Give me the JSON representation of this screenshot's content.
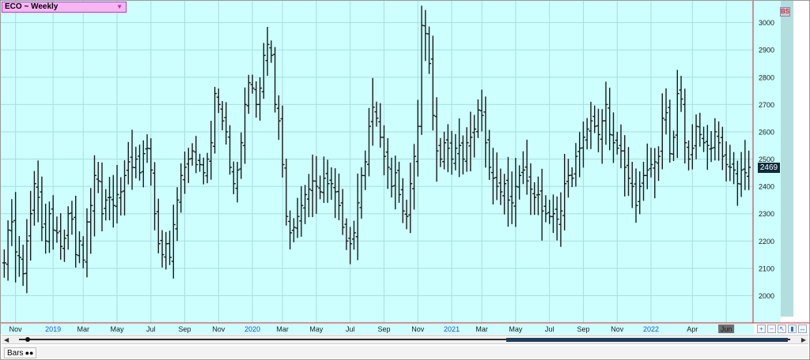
{
  "symbol_box": {
    "label": "ECO ~ Weekly"
  },
  "badge": "BS",
  "last_price_label": "2469",
  "status_tab": {
    "label": "Bars",
    "icon": "binoculars-icon"
  },
  "toolbar_icons": [
    "zoom-in-icon",
    "zoom-out-icon",
    "cursor-icon",
    "chart-icon",
    "expand-icon"
  ],
  "colors": {
    "background": "#ccfffe",
    "grid": "#a9dede",
    "bar": "#1a1a1a",
    "axis_band": "#b3dede",
    "red_line": "#d02030"
  },
  "chart_data": {
    "type": "ohlc",
    "ylim": [
      1900,
      3080
    ],
    "y_ticks": [
      2000,
      2100,
      2200,
      2300,
      2400,
      2500,
      2600,
      2700,
      2800,
      2900,
      3000
    ],
    "last_price": 2469,
    "x_ticks": [
      {
        "label": "Nov",
        "week": 3,
        "year": false
      },
      {
        "label": "2019",
        "week": 13,
        "year": true
      },
      {
        "label": "Mar",
        "week": 21,
        "year": false
      },
      {
        "label": "May",
        "week": 30,
        "year": false
      },
      {
        "label": "Jul",
        "week": 39,
        "year": false
      },
      {
        "label": "Sep",
        "week": 48,
        "year": false
      },
      {
        "label": "Nov",
        "week": 57,
        "year": false
      },
      {
        "label": "2020",
        "week": 66,
        "year": true
      },
      {
        "label": "Mar",
        "week": 74,
        "year": false
      },
      {
        "label": "May",
        "week": 83,
        "year": false
      },
      {
        "label": "Jul",
        "week": 92,
        "year": false
      },
      {
        "label": "Sep",
        "week": 101,
        "year": false
      },
      {
        "label": "Nov",
        "week": 110,
        "year": false
      },
      {
        "label": "2021",
        "week": 119,
        "year": true
      },
      {
        "label": "Mar",
        "week": 127,
        "year": false
      },
      {
        "label": "May",
        "week": 136,
        "year": false
      },
      {
        "label": "Jul",
        "week": 145,
        "year": false
      },
      {
        "label": "Sep",
        "week": 154,
        "year": false
      },
      {
        "label": "Nov",
        "week": 163,
        "year": false
      },
      {
        "label": "2022",
        "week": 172,
        "year": true
      },
      {
        "label": "Apr",
        "week": 183,
        "year": false
      },
      {
        "label": "Jun",
        "week": 192,
        "year": false
      }
    ],
    "values": [
      2120,
      2240,
      2270,
      2160,
      2140,
      2080,
      2200,
      2300,
      2410,
      2360,
      2250,
      2200,
      2300,
      2240,
      2230,
      2180,
      2210,
      2300,
      2280,
      2150,
      2200,
      2130,
      2270,
      2330,
      2440,
      2420,
      2300,
      2350,
      2360,
      2330,
      2370,
      2380,
      2440,
      2490,
      2470,
      2500,
      2450,
      2520,
      2540,
      2460,
      2300,
      2190,
      2150,
      2190,
      2140,
      2260,
      2350,
      2440,
      2470,
      2500,
      2530,
      2480,
      2480,
      2450,
      2500,
      2560,
      2740,
      2700,
      2640,
      2600,
      2470,
      2410,
      2460,
      2560,
      2700,
      2780,
      2760,
      2700,
      2760,
      2880,
      2920,
      2880,
      2700,
      2640,
      2480,
      2290,
      2230,
      2250,
      2290,
      2330,
      2370,
      2390,
      2420,
      2400,
      2380,
      2430,
      2410,
      2410,
      2380,
      2330,
      2250,
      2200,
      2190,
      2230,
      2340,
      2440,
      2490,
      2620,
      2690,
      2650,
      2580,
      2510,
      2470,
      2400,
      2450,
      2370,
      2310,
      2290,
      2410,
      2510,
      2620,
      2990,
      2960,
      2850,
      2660,
      2530,
      2500,
      2560,
      2540,
      2500,
      2540,
      2550,
      2500,
      2560,
      2580,
      2610,
      2680,
      2660,
      2560,
      2470,
      2430,
      2400,
      2380,
      2410,
      2350,
      2340,
      2400,
      2440,
      2460,
      2420,
      2390,
      2360,
      2370,
      2310,
      2300,
      2290,
      2300,
      2280,
      2310,
      2410,
      2440,
      2430,
      2510,
      2540,
      2580,
      2610,
      2640,
      2620,
      2590,
      2640,
      2700,
      2590,
      2560,
      2540,
      2530,
      2470,
      2430,
      2400,
      2330,
      2400,
      2440,
      2460,
      2480,
      2490,
      2510,
      2650,
      2670,
      2520,
      2580,
      2740,
      2720,
      2560,
      2500,
      2540,
      2620,
      2590,
      2560,
      2550,
      2540,
      2600,
      2560,
      2510,
      2480,
      2470,
      2460,
      2410,
      2460,
      2450,
      2470
    ]
  }
}
